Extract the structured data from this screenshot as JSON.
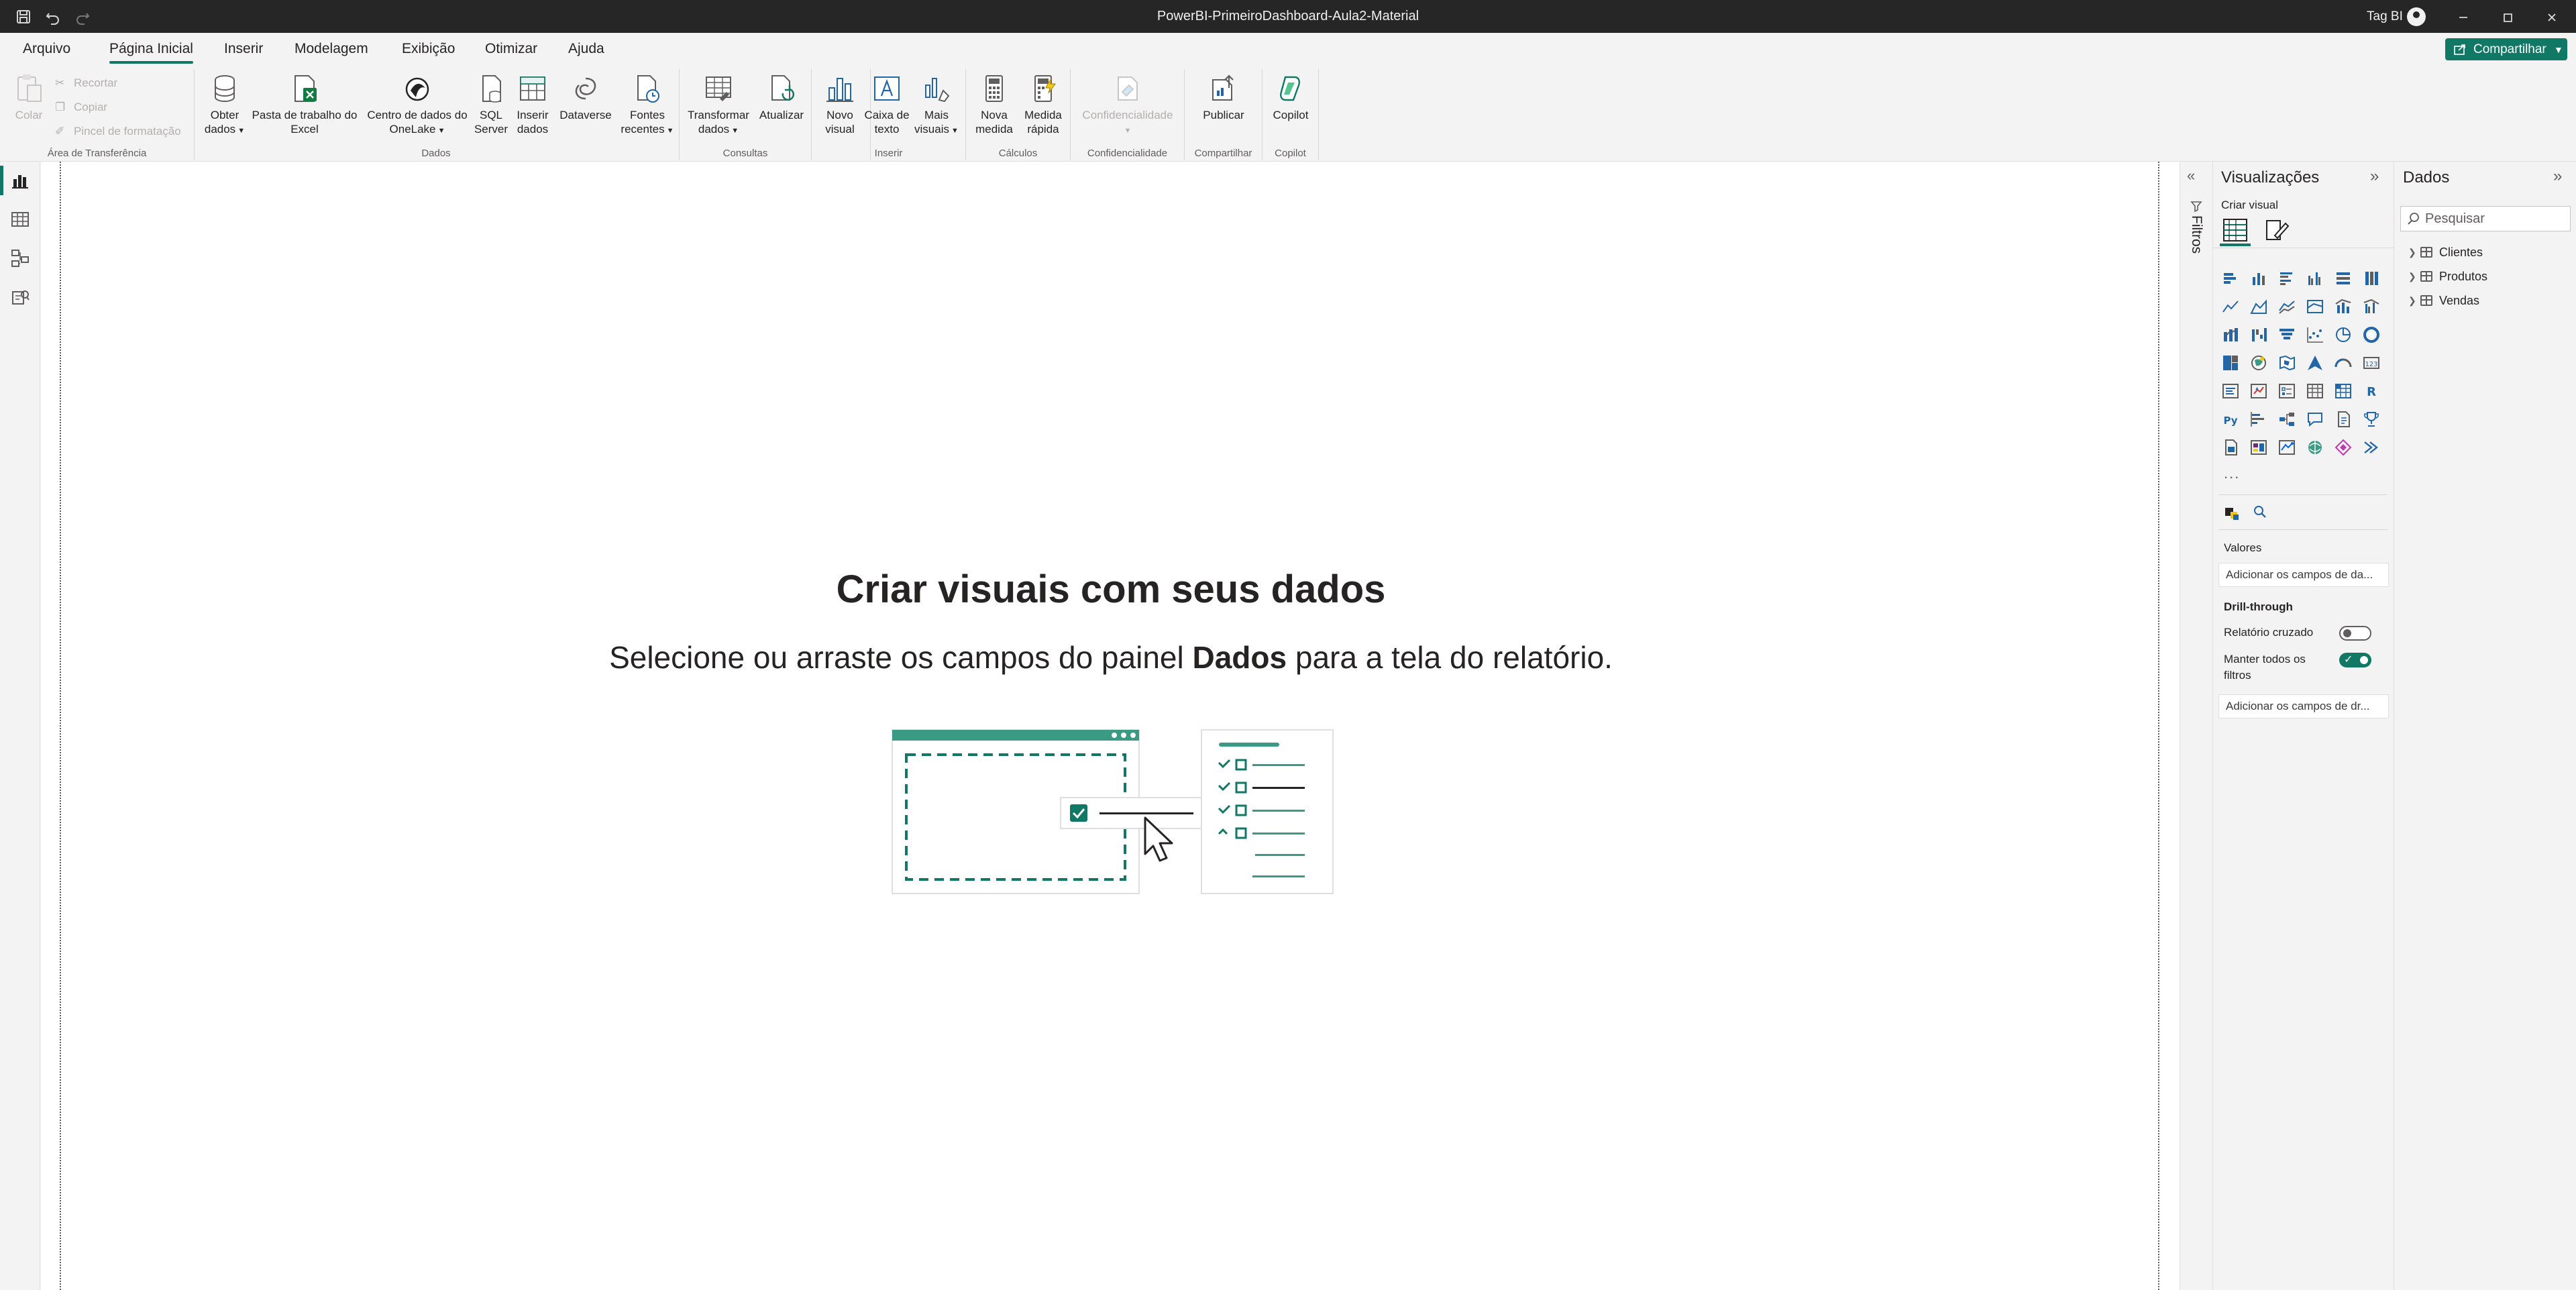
{
  "window": {
    "title": "PowerBI-PrimeiroDashboard-Aula2-Material",
    "user": "Tag BI"
  },
  "menu": {
    "tabs": [
      "Arquivo",
      "Página Inicial",
      "Inserir",
      "Modelagem",
      "Exibição",
      "Otimizar",
      "Ajuda"
    ],
    "active_tab": "Página Inicial",
    "share_label": "Compartilhar"
  },
  "ribbon": {
    "clipboard": {
      "paste": "Colar",
      "cut": "Recortar",
      "copy": "Copiar",
      "format_painter": "Pincel de formatação",
      "group": "Área de Transferência"
    },
    "data": {
      "get_data_1": "Obter",
      "get_data_2": "dados",
      "excel_1": "Pasta de trabalho do",
      "excel_2": "Excel",
      "onelake_1": "Centro de dados do",
      "onelake_2": "OneLake",
      "sql_1": "SQL",
      "sql_2": "Server",
      "enter_1": "Inserir",
      "enter_2": "dados",
      "dataverse": "Dataverse",
      "recent_1": "Fontes",
      "recent_2": "recentes",
      "group": "Dados"
    },
    "queries": {
      "transform_1": "Transformar",
      "transform_2": "dados",
      "refresh": "Atualizar",
      "group": "Consultas"
    },
    "insert": {
      "new_visual_1": "Novo",
      "new_visual_2": "visual",
      "textbox_1": "Caixa de",
      "textbox_2": "texto",
      "more_visuals_1": "Mais",
      "more_visuals_2": "visuais",
      "group": "Inserir"
    },
    "calculations": {
      "new_measure_1": "Nova",
      "new_measure_2": "medida",
      "quick_measure_1": "Medida",
      "quick_measure_2": "rápida",
      "group": "Cálculos"
    },
    "sensitivity": {
      "label": "Confidencialidade",
      "group": "Confidencialidade"
    },
    "share": {
      "publish": "Publicar",
      "group": "Compartilhar"
    },
    "copilot": {
      "label": "Copilot",
      "group": "Copilot"
    }
  },
  "canvas": {
    "empty_title": "Criar visuais com seus dados",
    "empty_sub_before": "Selecione ou arraste os campos do painel ",
    "empty_sub_bold": "Dados",
    "empty_sub_after": " para a tela do relatório."
  },
  "filters": {
    "label": "Filtros"
  },
  "visualizations": {
    "title": "Visualizações",
    "build_label": "Criar visual",
    "more": "...",
    "values_label": "Valores",
    "values_placeholder": "Adicionar os campos de da...",
    "drillthrough_label": "Drill-through",
    "cross_report_label": "Relatório cruzado",
    "cross_report_on": false,
    "keep_filters_label_1": "Manter todos os",
    "keep_filters_label_2": "filtros",
    "keep_filters_on": true,
    "drill_placeholder": "Adicionar os campos de dr..."
  },
  "data_pane": {
    "title": "Dados",
    "search_placeholder": "Pesquisar",
    "tables": [
      "Clientes",
      "Produtos",
      "Vendas"
    ]
  },
  "colors": {
    "accent": "#117865",
    "titlebar": "#262626",
    "ribbon_bg": "#f3f3f3",
    "excel_green": "#107c41",
    "chart_blue": "#2266a8"
  }
}
